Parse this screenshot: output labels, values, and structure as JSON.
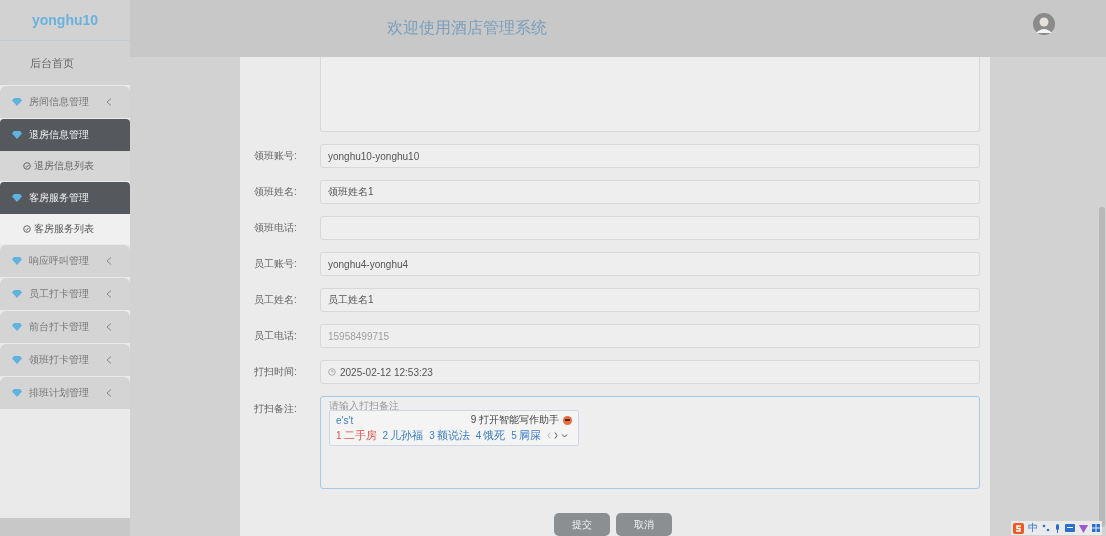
{
  "sidebar": {
    "username": "yonghu10",
    "items": [
      {
        "kind": "link",
        "label": "后台首页"
      },
      {
        "kind": "group",
        "label": "房间信息管理",
        "expanded": false
      },
      {
        "kind": "group",
        "label": "退房信息管理",
        "expanded": true,
        "children": [
          {
            "label": "退房信息列表",
            "selected": false
          }
        ]
      },
      {
        "kind": "group",
        "label": "客房服务管理",
        "expanded": true,
        "children": [
          {
            "label": "客房服务列表",
            "selected": true
          }
        ]
      },
      {
        "kind": "group",
        "label": "响应呼叫管理",
        "expanded": false
      },
      {
        "kind": "group",
        "label": "员工打卡管理",
        "expanded": false
      },
      {
        "kind": "group",
        "label": "前台打卡管理",
        "expanded": false
      },
      {
        "kind": "group",
        "label": "领班打卡管理",
        "expanded": false
      },
      {
        "kind": "group",
        "label": "排班计划管理",
        "expanded": false
      }
    ]
  },
  "header": {
    "title": "欢迎使用酒店管理系统"
  },
  "form": {
    "fields": [
      {
        "kind": "textarea_top"
      },
      {
        "kind": "text",
        "label": "领班账号:",
        "value": "yonghu10-yonghu10",
        "disabled": false
      },
      {
        "kind": "text",
        "label": "领班姓名:",
        "value": "领班姓名1",
        "disabled": false
      },
      {
        "kind": "text",
        "label": "领班电话:"
      },
      {
        "kind": "text",
        "label": "员工账号:",
        "value": "yonghu4-yonghu4",
        "disabled": false
      },
      {
        "kind": "text",
        "label": "员工姓名:",
        "value": "员工姓名1",
        "disabled": false
      },
      {
        "kind": "text",
        "label": "员工电话:",
        "value": "15958499715",
        "disabled": true
      },
      {
        "kind": "date",
        "label": "打扫时间:",
        "value": "2025-02-12 12:53:23",
        "disabled": false
      },
      {
        "kind": "textarea",
        "label": "打扫备注:",
        "placeholder": "请输入打扫备注",
        "focused": true
      }
    ],
    "buttons": [
      "提交",
      "取消"
    ]
  },
  "ime": {
    "composition": "e's't",
    "hint": "9 打开智能写作助手",
    "candidates": [
      {
        "number": "1",
        "text": "二手房",
        "selected": true
      },
      {
        "number": "2",
        "text": "儿孙福",
        "selected": false
      },
      {
        "number": "3",
        "text": "额说法",
        "selected": false
      },
      {
        "number": "4",
        "text": "饿死",
        "selected": false
      },
      {
        "number": "5",
        "text": "屙屎",
        "selected": false
      }
    ]
  },
  "ime_toolbar": {
    "mode": "中"
  }
}
